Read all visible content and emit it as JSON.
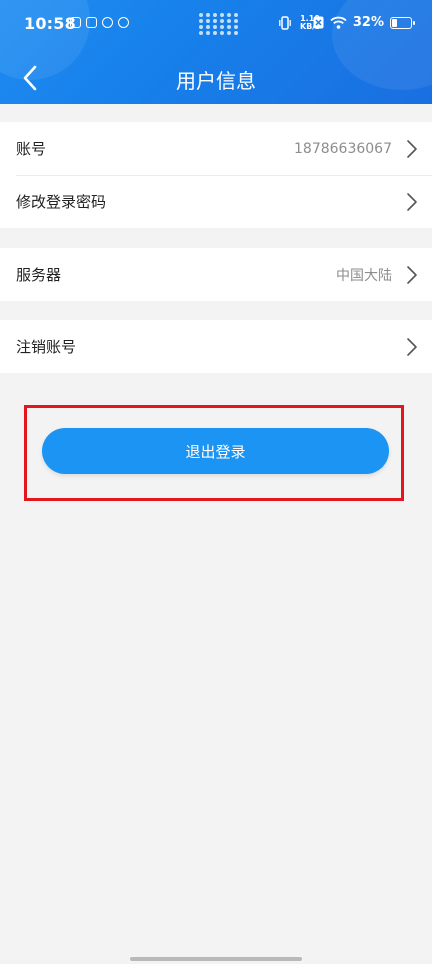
{
  "status_bar": {
    "time": "10:58",
    "network_speed_value": "1.10",
    "network_speed_unit": "KB/s",
    "battery_percent": "32%",
    "battery_level": 0.32
  },
  "nav": {
    "title": "用户信息"
  },
  "rows": {
    "account": {
      "label": "账号",
      "value": "18786636067"
    },
    "change_password": {
      "label": "修改登录密码"
    },
    "server": {
      "label": "服务器",
      "value": "中国大陆"
    },
    "deactivate": {
      "label": "注销账号"
    }
  },
  "logout_button": {
    "label": "退出登录"
  },
  "colors": {
    "header_blue": "#1780ea",
    "button_blue": "#1b94f3",
    "highlight_red": "#e3161e",
    "background": "#f3f3f3"
  }
}
